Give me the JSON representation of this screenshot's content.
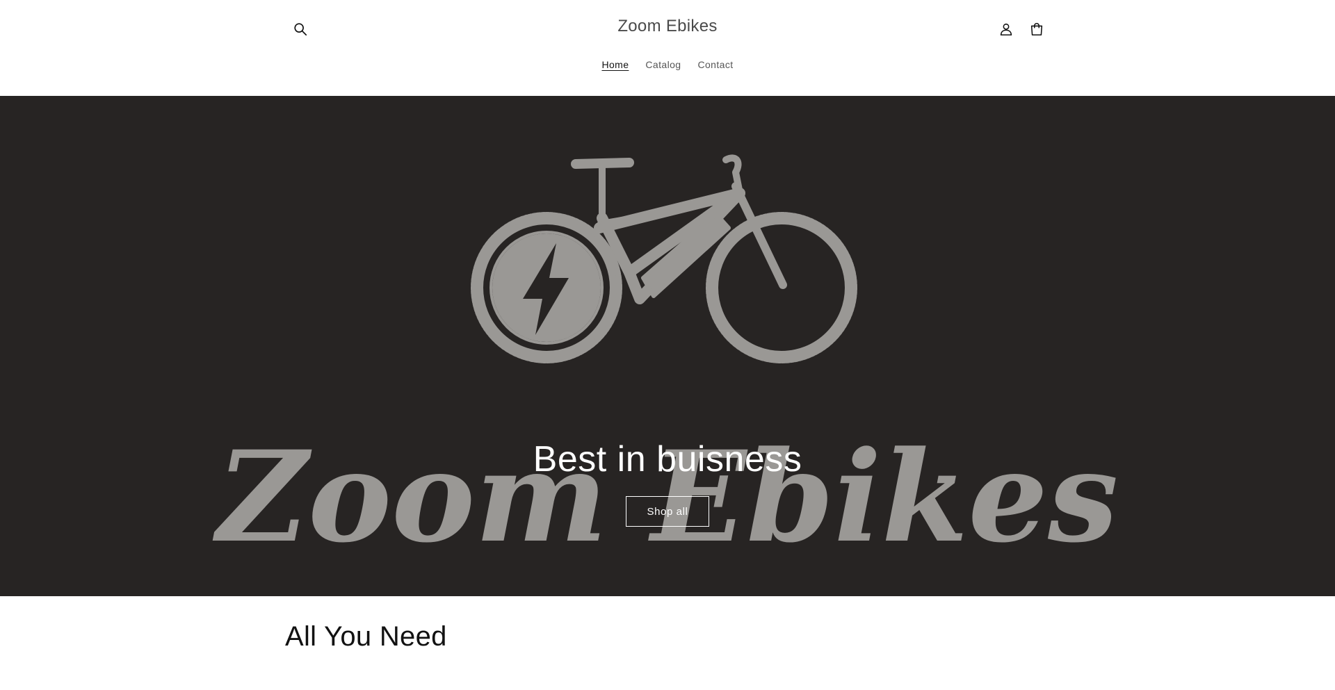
{
  "header": {
    "store_name": "Zoom Ebikes",
    "icons": {
      "search": "search-icon",
      "account": "account-icon",
      "cart": "cart-icon"
    },
    "nav": [
      {
        "label": "Home",
        "active": true
      },
      {
        "label": "Catalog",
        "active": false
      },
      {
        "label": "Contact",
        "active": false
      }
    ]
  },
  "hero": {
    "title": "Best in buisness",
    "cta_label": "Shop all",
    "background_color": "#272423",
    "logo_text": "Zoom Ebikes"
  },
  "collection": {
    "title": "All You Need"
  },
  "colors": {
    "text": "#121212",
    "muted": "#555555",
    "hero_bg": "#272423",
    "logo_gray": "#9a9895"
  }
}
